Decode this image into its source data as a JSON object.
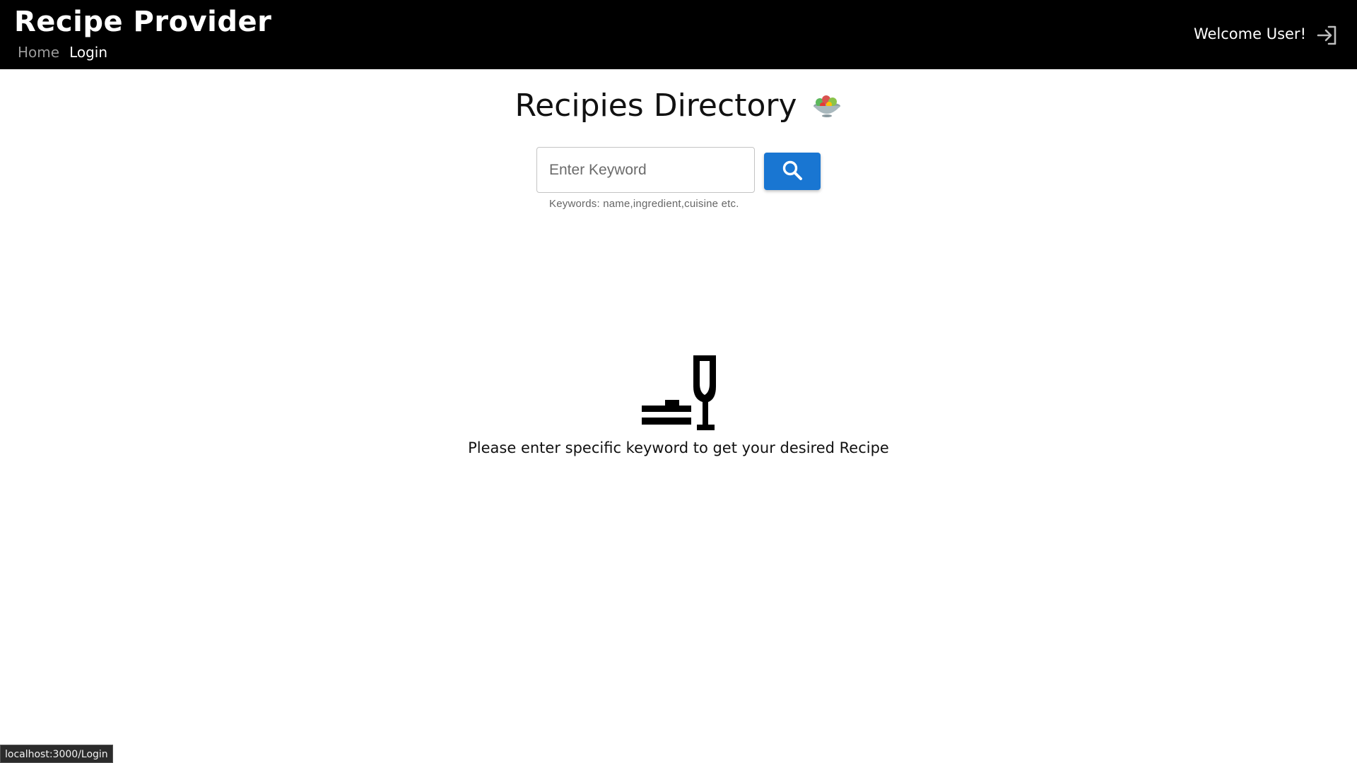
{
  "header": {
    "brand": "Recipe Provider",
    "nav": [
      {
        "label": "Home"
      },
      {
        "label": "Login"
      }
    ],
    "welcome_text": "Welcome User!",
    "login_icon": "login-arrow-icon"
  },
  "main": {
    "title": "Recipies Directory",
    "title_icon": "salad-bowl-icon",
    "search": {
      "value": "",
      "placeholder": "Enter Keyword",
      "helper": "Keywords: name,ingredient,cuisine etc.",
      "button_icon": "search-icon"
    },
    "empty_state": {
      "icon": "dining-icon",
      "message": "Please enter specific keyword to get your desired Recipe"
    }
  },
  "status_bar": {
    "url": "localhost:3000/Login"
  },
  "colors": {
    "navbar_bg": "#000000",
    "accent": "#1976d2",
    "nav_inactive": "#9a9a9a"
  }
}
